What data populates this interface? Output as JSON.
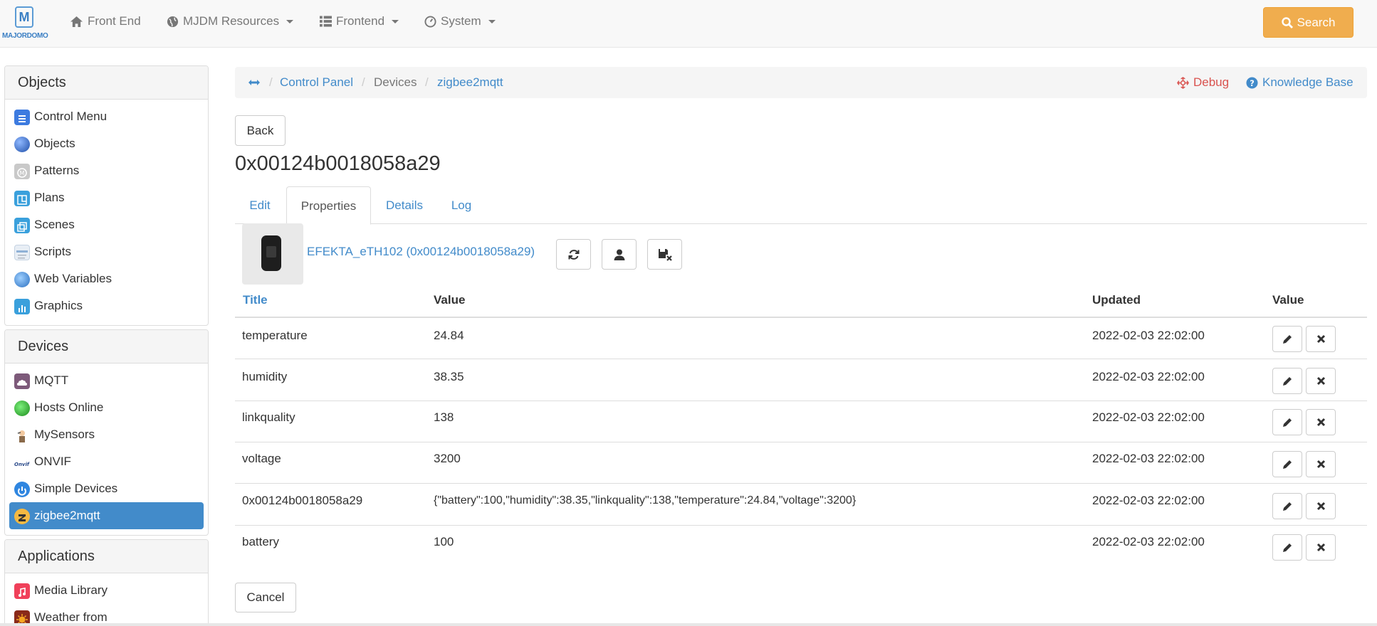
{
  "navbar": {
    "logo_letter": "M",
    "logo_text": "MAJORDOMO",
    "items": [
      {
        "label": "Front End"
      },
      {
        "label": "MJDM Resources"
      },
      {
        "label": "Frontend"
      },
      {
        "label": "System"
      }
    ],
    "search_label": "Search"
  },
  "sidebar": {
    "objects": {
      "title": "Objects",
      "items": [
        {
          "label": "Control Menu"
        },
        {
          "label": "Objects"
        },
        {
          "label": "Patterns"
        },
        {
          "label": "Plans"
        },
        {
          "label": "Scenes"
        },
        {
          "label": "Scripts"
        },
        {
          "label": "Web Variables"
        },
        {
          "label": "Graphics"
        }
      ]
    },
    "devices": {
      "title": "Devices",
      "items": [
        {
          "label": "MQTT"
        },
        {
          "label": "Hosts Online"
        },
        {
          "label": "MySensors"
        },
        {
          "label": "ONVIF"
        },
        {
          "label": "Simple Devices"
        },
        {
          "label": "zigbee2mqtt"
        }
      ]
    },
    "applications": {
      "title": "Applications",
      "items": [
        {
          "label": "Media Library"
        },
        {
          "label": "Weather from"
        }
      ]
    }
  },
  "breadcrumb": {
    "items": [
      "Control Panel",
      "Devices",
      "zigbee2mqtt"
    ],
    "debug": "Debug",
    "knowledge_base": "Knowledge Base"
  },
  "main": {
    "back_label": "Back",
    "title": "0x00124b0018058a29",
    "tabs": [
      "Edit",
      "Properties",
      "Details",
      "Log"
    ],
    "device_link": "EFEKTA_eTH102 (0x00124b0018058a29)",
    "cancel_label": "Cancel"
  },
  "table": {
    "headers": [
      "Title",
      "Value",
      "Updated",
      "Value"
    ],
    "rows": [
      {
        "title": "temperature",
        "value": "24.84",
        "updated": "2022-02-03 22:02:00"
      },
      {
        "title": "humidity",
        "value": "38.35",
        "updated": "2022-02-03 22:02:00"
      },
      {
        "title": "linkquality",
        "value": "138",
        "updated": "2022-02-03 22:02:00"
      },
      {
        "title": "voltage",
        "value": "3200",
        "updated": "2022-02-03 22:02:00"
      },
      {
        "title": "0x00124b0018058a29",
        "value": "{\"battery\":100,\"humidity\":38.35,\"linkquality\":138,\"temperature\":24.84,\"voltage\":3200}",
        "updated": "2022-02-03 22:02:00"
      },
      {
        "title": "battery",
        "value": "100",
        "updated": "2022-02-03 22:02:00"
      }
    ]
  },
  "colors": {
    "link": "#428bca",
    "debug": "#d9534f",
    "search": "#f0ad4e",
    "active": "#428bca"
  }
}
